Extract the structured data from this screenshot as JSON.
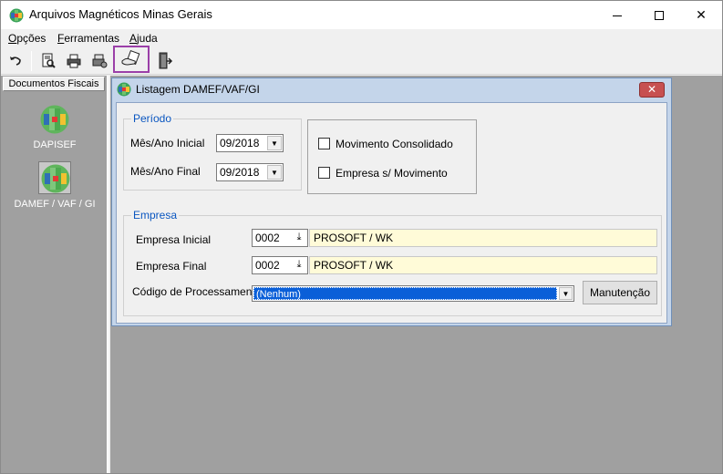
{
  "window": {
    "title": "Arquivos Magnéticos Minas Gerais",
    "minimize": "—",
    "maximize": "☐",
    "close": "✕"
  },
  "menu": [
    "Opções",
    "Ferramentas",
    "Ajuda"
  ],
  "sidebar": {
    "header": "Documentos Fiscais",
    "items": [
      {
        "label": "DAPISEF",
        "icon": "grid-logo-icon"
      },
      {
        "label": "DAMEF / VAF / GI",
        "icon": "grid-logo-icon"
      }
    ]
  },
  "child": {
    "title": "Listagem DAMEF/VAF/GI",
    "close": "✕",
    "periodo": {
      "legend": "Período",
      "inicial_label": "Mês/Ano Inicial",
      "inicial_value": "09/2018",
      "final_label": "Mês/Ano Final",
      "final_value": "09/2018"
    },
    "options": {
      "movimento_consolidado": "Movimento Consolidado",
      "empresa_sem_movimento": "Empresa s/ Movimento"
    },
    "empresa": {
      "legend": "Empresa",
      "inicial_label": "Empresa Inicial",
      "inicial_code": "0002",
      "inicial_name": "PROSOFT / WK",
      "final_label": "Empresa Final",
      "final_code": "0002",
      "final_name": "PROSOFT / WK",
      "processo_label": "Código de Processamento",
      "processo_value": "(Nenhum)",
      "manutencao": "Manutenção"
    }
  },
  "colors": {
    "accent_highlight": "#9b3fa8",
    "legend_blue": "#0a56c0",
    "selection_blue": "#0a5fd8",
    "field_yellow": "#fffbd8",
    "mdi_gray": "#a0a0a0"
  }
}
